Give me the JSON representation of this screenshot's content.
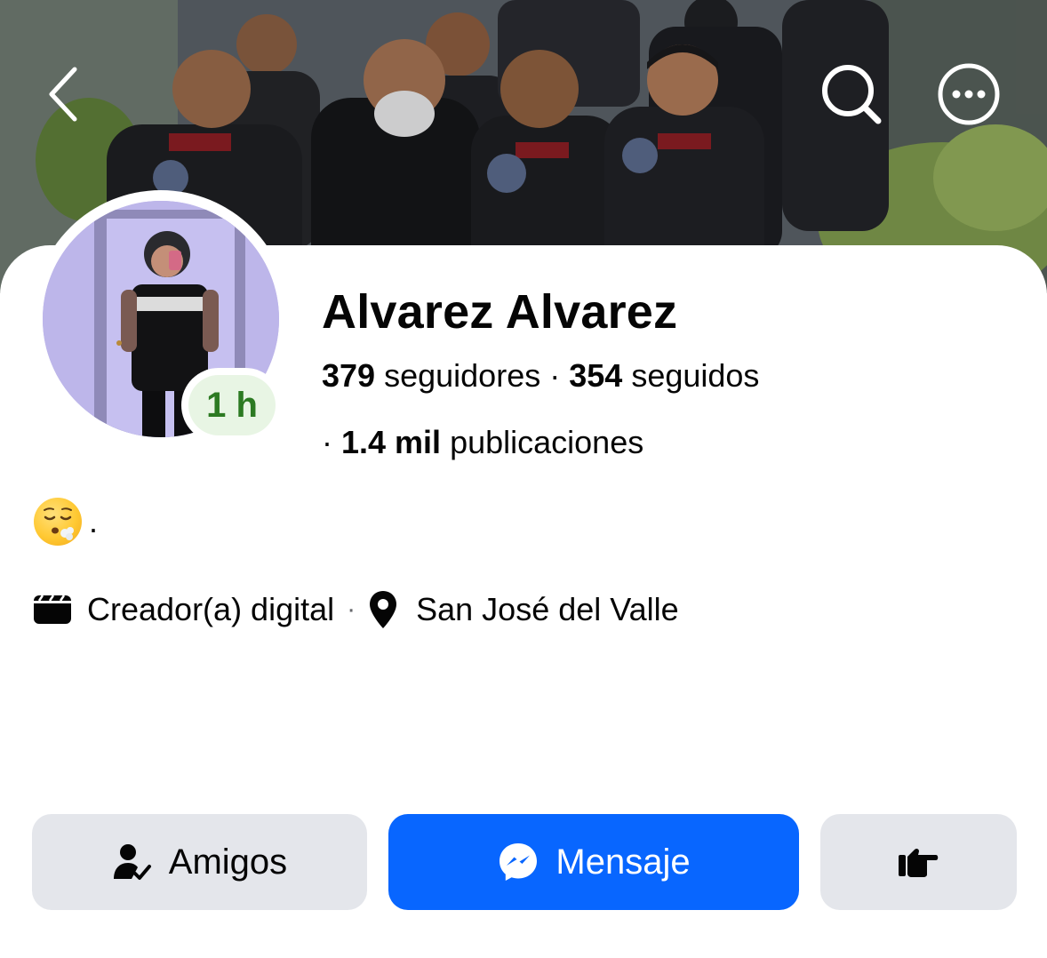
{
  "profile": {
    "name": "Alvarez Alvarez",
    "followers_count": "379",
    "followers_label": "seguidores",
    "following_count": "354",
    "following_label": "seguidos",
    "posts_count": "1.4 mil",
    "posts_label": "publicaciones",
    "active_badge": "1 h",
    "bio": ".",
    "category": "Creador(a) digital",
    "location": "San José del Valle"
  },
  "actions": {
    "friends_label": "Amigos",
    "message_label": "Mensaje"
  },
  "icons": {
    "back": "chevron-left-icon",
    "search": "search-icon",
    "more": "more-options-icon",
    "category": "clapperboard-icon",
    "location": "location-pin-icon",
    "friends": "friends-check-icon",
    "message": "messenger-icon",
    "poke": "poke-hand-icon",
    "bio_emoji": "exhaling-face-emoji"
  },
  "colors": {
    "primary": "#0866ff",
    "button_gray": "#e4e6eb",
    "active_green": "#2c7a22",
    "active_bg": "#e8f5e4"
  }
}
